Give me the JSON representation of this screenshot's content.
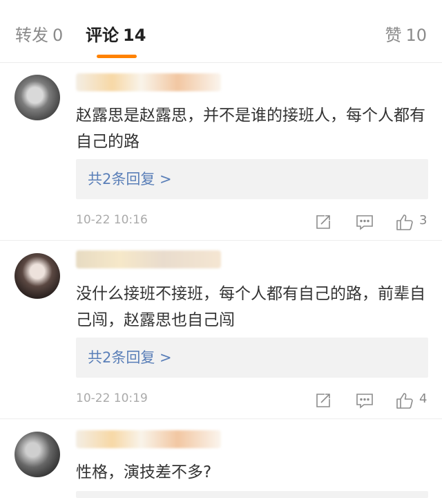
{
  "tabs": [
    {
      "label": "转发",
      "count": "0"
    },
    {
      "label": "评论",
      "count": "14"
    },
    {
      "label": "赞",
      "count": "10"
    }
  ],
  "colors": {
    "accent": "#ff8200",
    "link": "#5a7fb8",
    "muted": "#aaaaaa"
  },
  "comments": [
    {
      "text": "赵露思是赵露思，并不是谁的接班人，每个人都有自己的路",
      "replies_label": "共2条回复 >",
      "time": "10-22 10:16",
      "likes": "3"
    },
    {
      "text": "没什么接班不接班，每个人都有自己的路，前辈自己闯，赵露思也自己闯",
      "replies_label": "共2条回复 >",
      "time": "10-22 10:19",
      "likes": "4"
    },
    {
      "text": "性格，演技差不多?"
    }
  ],
  "icons": {
    "repost": "edit-share-icon",
    "comment": "comment-bubble-icon",
    "like": "thumbs-up-icon"
  }
}
